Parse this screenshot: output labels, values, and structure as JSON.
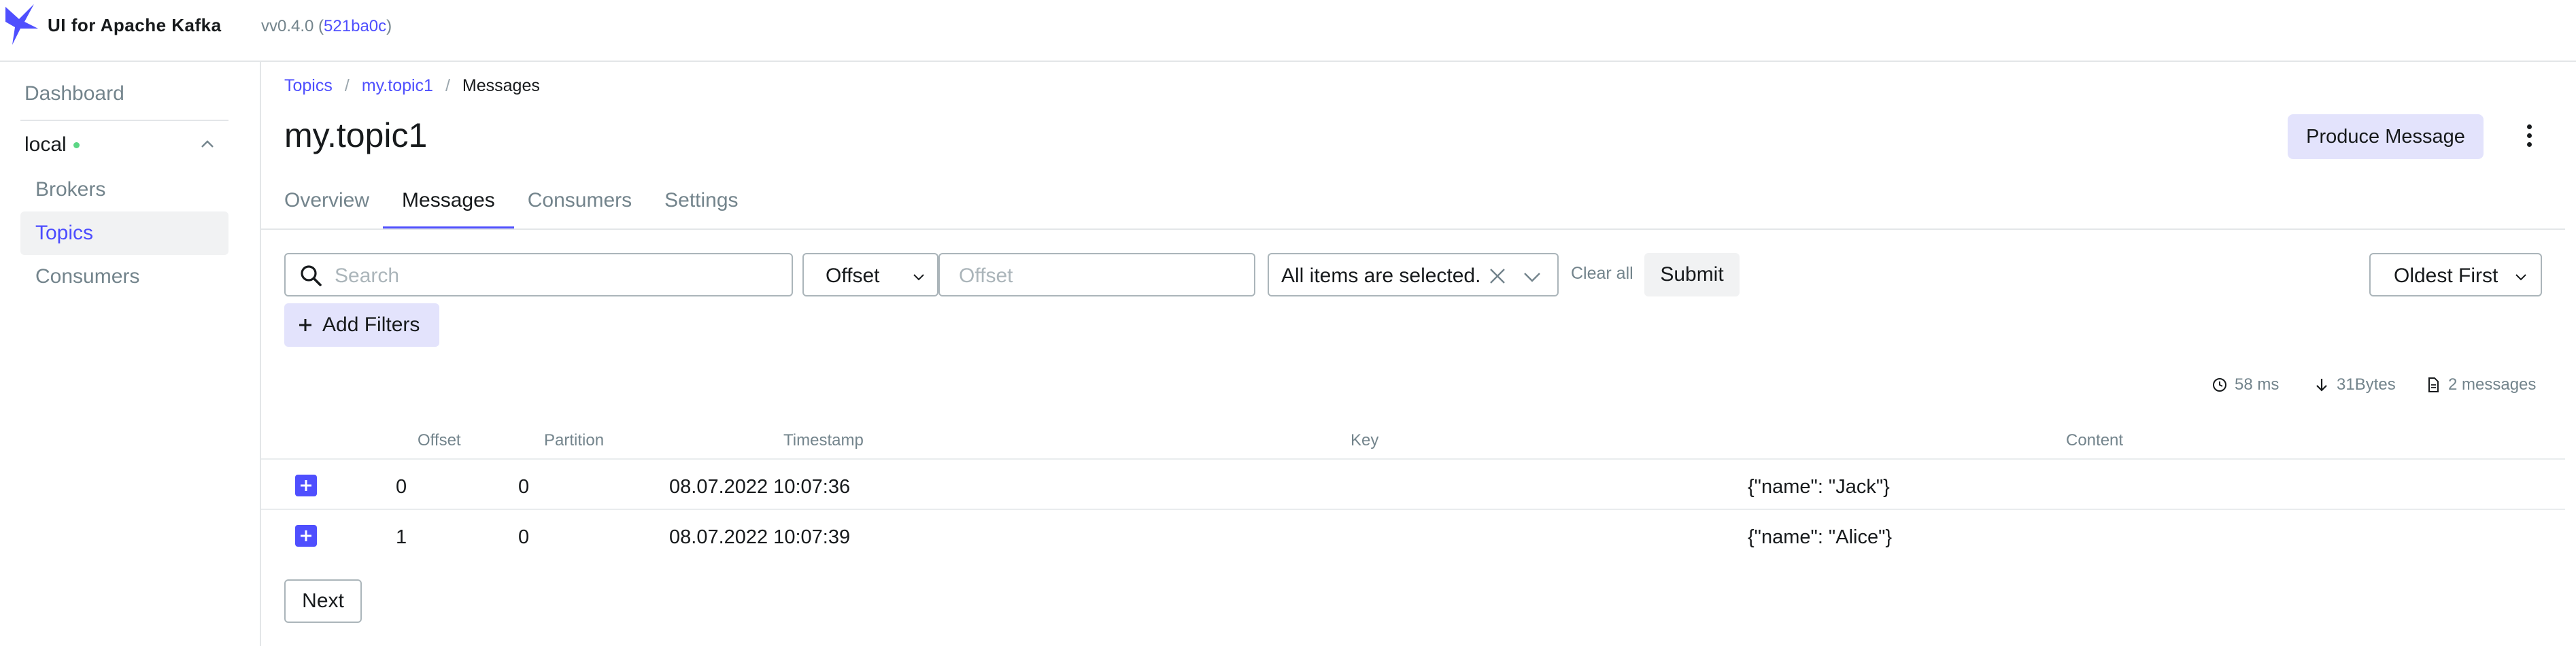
{
  "app": {
    "title": "UI for Apache Kafka",
    "version_prefix": "vv0.4.0 (",
    "version_hash": "521ba0c",
    "version_suffix": ")"
  },
  "sidebar": {
    "dashboard": "Dashboard",
    "cluster": "local",
    "items": [
      {
        "label": "Brokers"
      },
      {
        "label": "Topics"
      },
      {
        "label": "Consumers"
      }
    ]
  },
  "breadcrumb": {
    "root": "Topics",
    "topic": "my.topic1",
    "current": "Messages"
  },
  "page": {
    "title": "my.topic1",
    "produce_label": "Produce Message"
  },
  "tabs": [
    {
      "label": "Overview"
    },
    {
      "label": "Messages"
    },
    {
      "label": "Consumers"
    },
    {
      "label": "Settings"
    }
  ],
  "filters": {
    "search_placeholder": "Search",
    "seek_type": "Offset",
    "offset_placeholder": "Offset",
    "partitions_value": "All items are selected.",
    "clear_all": "Clear all",
    "submit": "Submit",
    "sort": "Oldest First",
    "add_filters": "Add Filters"
  },
  "meta": {
    "time": "58 ms",
    "bytes": "31Bytes",
    "count": "2 messages"
  },
  "table": {
    "headers": {
      "offset": "Offset",
      "partition": "Partition",
      "timestamp": "Timestamp",
      "key": "Key",
      "content": "Content"
    },
    "rows": [
      {
        "offset": "0",
        "partition": "0",
        "timestamp": "08.07.2022 10:07:36",
        "key": "",
        "content": "{\"name\": \"Jack\"}"
      },
      {
        "offset": "1",
        "partition": "0",
        "timestamp": "08.07.2022 10:07:39",
        "key": "",
        "content": "{\"name\": \"Alice\"}"
      }
    ]
  },
  "pagination": {
    "next": "Next"
  },
  "colors": {
    "accent": "#4f4ffe",
    "accent_soft": "#e3e3fc",
    "status_ok": "#5cd685",
    "muted": "#73848c"
  }
}
